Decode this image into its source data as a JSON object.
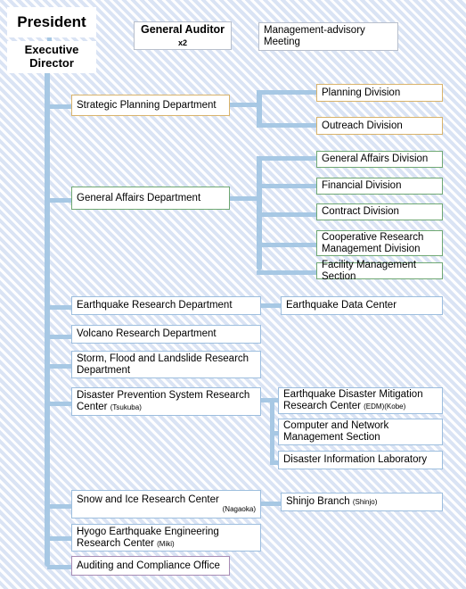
{
  "meta": {
    "title": "Organization Chart",
    "colors": {
      "background": "#eaf0fa",
      "connector": "#a7c8e4",
      "border_blue": "#9dbede",
      "border_orange": "#d9b36b",
      "border_green": "#6fa873",
      "border_purple": "#a88cb5",
      "border_gray": "#b8bfcc"
    }
  },
  "top": {
    "president": "President",
    "executive_director": "Executive Director",
    "general_auditor": "General Auditor",
    "general_auditor_count": "x2",
    "management_advisory_meeting": "Management-advisory Meeting"
  },
  "departments": [
    {
      "label": "Strategic Planning  Department",
      "location": "",
      "children": [
        {
          "label": "Planning Division",
          "location": ""
        },
        {
          "label": "Outreach Division",
          "location": ""
        }
      ]
    },
    {
      "label": "General Affairs Department",
      "location": "",
      "children": [
        {
          "label": "General Affairs Division",
          "location": ""
        },
        {
          "label": "Financial Division",
          "location": ""
        },
        {
          "label": "Contract Division",
          "location": ""
        },
        {
          "label": "Cooperative Research Management Division",
          "location": ""
        },
        {
          "label": "Facility Management Section",
          "location": ""
        }
      ]
    },
    {
      "label": "Earthquake Research Department",
      "location": "",
      "children": [
        {
          "label": "Earthquake Data Center",
          "location": ""
        }
      ]
    },
    {
      "label": "Volcano Research Department",
      "location": "",
      "children": []
    },
    {
      "label": "Storm, Flood and Landslide Research Department",
      "location": "",
      "children": []
    },
    {
      "label": "Disaster Prevention System Research Center",
      "location": "(Tsukuba)",
      "children": [
        {
          "label": "Earthquake Disaster Mitigation Research Center",
          "location": "(EDM)(Kobe)"
        },
        {
          "label": "Computer and Network Management Section",
          "location": ""
        },
        {
          "label": "Disaster Information Laboratory",
          "location": ""
        }
      ]
    },
    {
      "label": "Snow and Ice Research Center",
      "location": "(Nagaoka)",
      "children": [
        {
          "label": "Shinjo Branch",
          "location": "(Shinjo)"
        }
      ]
    },
    {
      "label": "Hyogo Earthquake Engineering Research Center",
      "location": "(Miki)",
      "children": []
    },
    {
      "label": "Auditing and Compliance Office",
      "location": "",
      "children": []
    }
  ]
}
